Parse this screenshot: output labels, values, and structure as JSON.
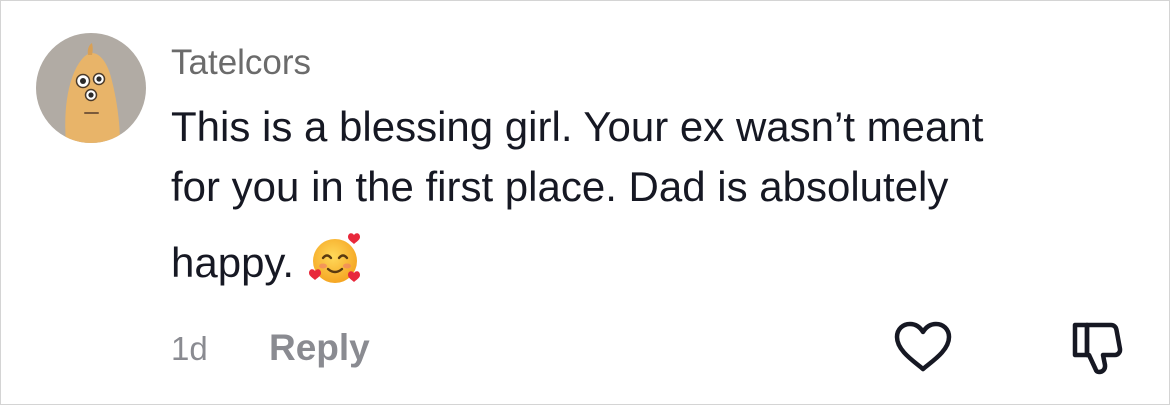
{
  "comment": {
    "username": "Tatelcors",
    "text_lines": [
      "This is a blessing girl. Your ex wasn’t meant",
      "for you in the first place. Dad is absolutely",
      "happy."
    ],
    "emoji": "smiling-face-with-hearts-icon",
    "time": "1d",
    "reply_label": "Reply"
  },
  "icons": {
    "like": "heart-outline-icon",
    "dislike": "thumbs-down-outline-icon"
  },
  "colors": {
    "username": "#6b6b6b",
    "text": "#161823",
    "muted": "#8a8b91",
    "avatar_bg": "#b1aba4",
    "avatar_figure": "#e8b469"
  }
}
